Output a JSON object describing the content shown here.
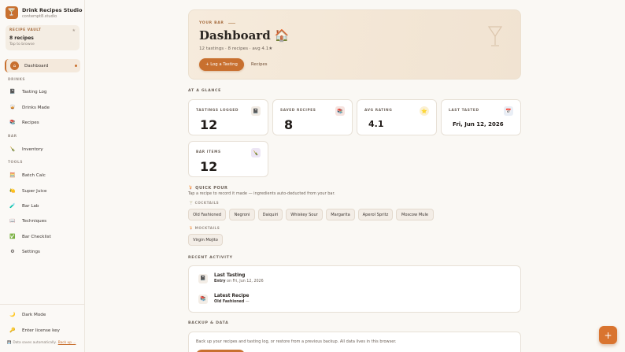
{
  "brand": {
    "title": "Drink Recipes Studio",
    "subtitle": "contempt8.studio",
    "icon": "cocktail-icon"
  },
  "vault": {
    "label": "RECIPE VAULT",
    "count": "8 recipes",
    "hint": "Tap to browse"
  },
  "sidebar": {
    "dashboard": "Dashboard",
    "sections": {
      "drinks": "DRINKS",
      "bar": "BAR",
      "tools": "TOOLS"
    },
    "drinks": [
      {
        "label": "Tasting Log",
        "icon": "notebook-icon"
      },
      {
        "label": "Drinks Made",
        "icon": "glass-icon"
      },
      {
        "label": "Recipes",
        "icon": "books-icon"
      }
    ],
    "bar": [
      {
        "label": "Inventory",
        "icon": "bottle-icon"
      }
    ],
    "tools": [
      {
        "label": "Batch Calc",
        "icon": "calculator-icon"
      },
      {
        "label": "Super Juice",
        "icon": "citrus-icon"
      },
      {
        "label": "Bar Lab",
        "icon": "flask-icon"
      },
      {
        "label": "Techniques",
        "icon": "book-icon"
      },
      {
        "label": "Bar Checklist",
        "icon": "checklist-icon"
      },
      {
        "label": "Settings",
        "icon": "gear-icon"
      }
    ],
    "dark_mode": "Dark Mode",
    "license": "Enter license key",
    "footer_note": "Data saves automatically.",
    "footer_link": "Back up ..."
  },
  "hero": {
    "eyebrow": "YOUR BAR",
    "title": "Dashboard 🏠",
    "stats": "12 tastings · 8 recipes · avg 4.1★",
    "primary_button": "+ Log a Tasting",
    "secondary_link": "Recipes"
  },
  "glance": {
    "heading": "AT A GLANCE",
    "cards": [
      {
        "label": "TASTINGS LOGGED",
        "value": "12",
        "icon": "notebook-icon"
      },
      {
        "label": "SAVED RECIPES",
        "value": "8",
        "icon": "books-icon"
      },
      {
        "label": "AVG RATING",
        "value": "4.1",
        "icon": "star-icon"
      },
      {
        "label": "LAST TASTED",
        "value": "Fri, Jun 12, 2026",
        "icon": "calendar-icon"
      },
      {
        "label": "BAR ITEMS",
        "value": "12",
        "icon": "bottle-icon"
      }
    ]
  },
  "quick_pour": {
    "title": "🍹 QUICK POUR",
    "description": "Tap a recipe to record it made — ingredients auto-deducted from your bar.",
    "cocktails_label": "🍸 COCKTAILS",
    "cocktails": [
      "Old Fashioned",
      "Negroni",
      "Daiquiri",
      "Whiskey Sour",
      "Margarita",
      "Aperol Spritz",
      "Moscow Mule"
    ],
    "mocktails_label": "🍹 MOCKTAILS",
    "mocktails": [
      "Virgin Mojito"
    ]
  },
  "activity": {
    "heading": "RECENT ACTIVITY",
    "last_tasting": {
      "title": "Last Tasting",
      "bold": "Entry",
      "rest": " on Fri, Jun 12, 2026"
    },
    "latest_recipe": {
      "title": "Latest Recipe",
      "bold": "Old Fashioned",
      "rest": " —"
    }
  },
  "backup": {
    "heading": "BACKUP & DATA",
    "description": "Back up your recipes and tasting log, or restore from a previous backup. All data lives in this browser."
  },
  "fab": "+",
  "colors": {
    "accent": "#c8702f",
    "background": "#faf8f4",
    "sidebar": "#fbf9f6"
  }
}
